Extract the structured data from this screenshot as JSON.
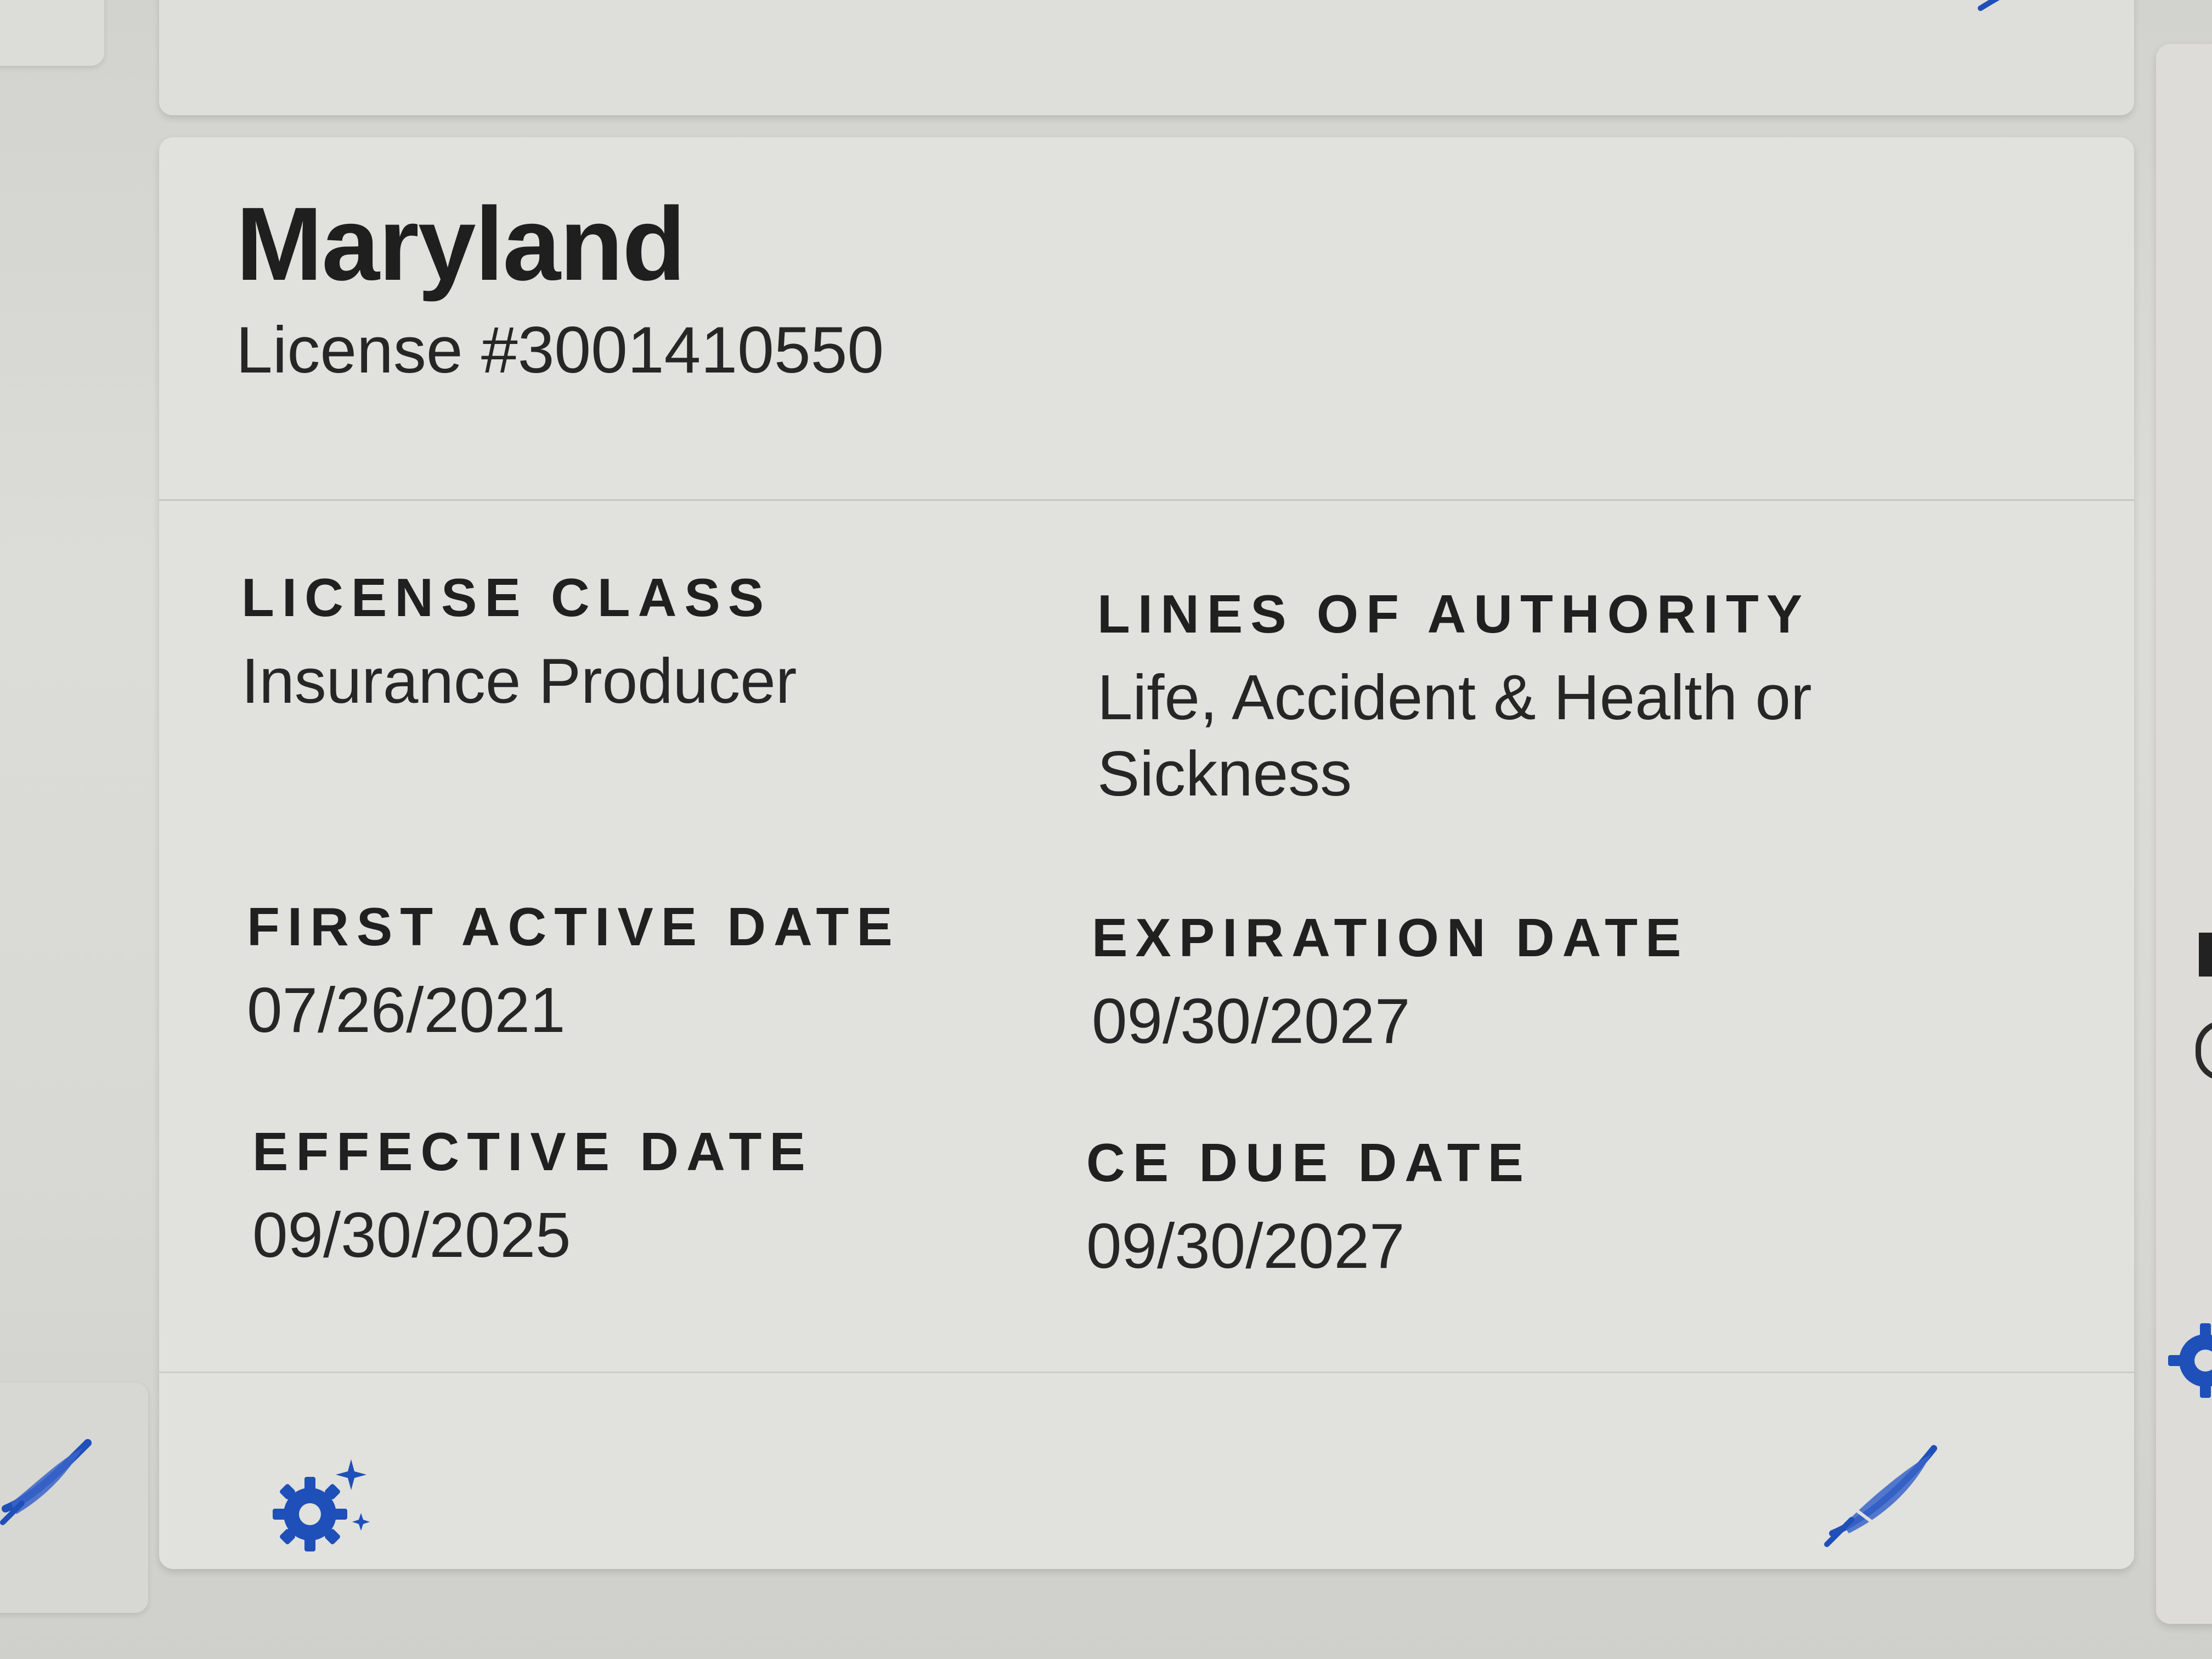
{
  "license_card": {
    "state": "Maryland",
    "license_number": "License #3001410550",
    "fields": {
      "license_class": {
        "label": "LICENSE CLASS",
        "value": "Insurance Producer"
      },
      "lines_of_authority": {
        "label": "LINES OF AUTHORITY",
        "value": "Life, Accident & Health or Sickness"
      },
      "first_active_date": {
        "label": "FIRST ACTIVE DATE",
        "value": "07/26/2021"
      },
      "expiration_date": {
        "label": "EXPIRATION DATE",
        "value": "09/30/2027"
      },
      "effective_date": {
        "label": "EFFECTIVE DATE",
        "value": "09/30/2025"
      },
      "ce_due_date": {
        "label": "CE DUE DATE",
        "value": "09/30/2027"
      }
    },
    "actions": {
      "settings_icon": "gear-sparkle-icon",
      "edit_icon": "quill-pen-icon"
    }
  },
  "colors": {
    "icon_blue": "#1f4fb8",
    "text_dark": "#1f1f1f",
    "card_bg": "#e1e1dd"
  }
}
